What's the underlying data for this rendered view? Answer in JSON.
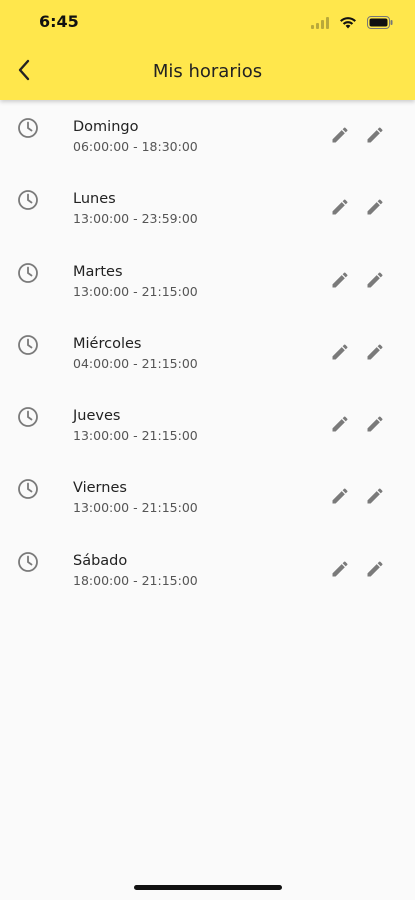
{
  "status_bar": {
    "time": "6:45"
  },
  "header": {
    "title": "Mis horarios",
    "back_icon": "chevron-left-icon",
    "background": "#FFE74C"
  },
  "schedules": [
    {
      "day": "Domingo",
      "hours": "06:00:00 - 18:30:00"
    },
    {
      "day": "Lunes",
      "hours": "13:00:00 - 23:59:00"
    },
    {
      "day": "Martes",
      "hours": "13:00:00 - 21:15:00"
    },
    {
      "day": "Miércoles",
      "hours": "04:00:00 - 21:15:00"
    },
    {
      "day": "Jueves",
      "hours": "13:00:00 - 21:15:00"
    },
    {
      "day": "Viernes",
      "hours": "13:00:00 - 21:15:00"
    },
    {
      "day": "Sábado",
      "hours": "18:00:00 - 21:15:00"
    }
  ],
  "icons": {
    "row_icon": "clock-icon",
    "action_icon": "pencil-icon"
  },
  "colors": {
    "accent": "#FFE74C",
    "icon": "#7a7a7a",
    "background": "#FAFAFA"
  }
}
